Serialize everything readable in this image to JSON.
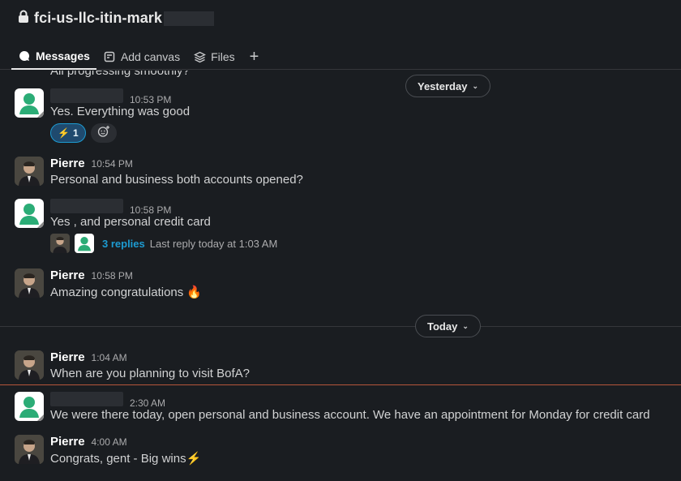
{
  "channel": {
    "name": "fci-us-llc-itin-mark"
  },
  "tabs": [
    {
      "label": "Messages",
      "icon": "chat-bubble-icon"
    },
    {
      "label": "Add canvas",
      "icon": "canvas-icon"
    },
    {
      "label": "Files",
      "icon": "layers-icon"
    }
  ],
  "add_tab_label": "+",
  "partial_message": "All progressing smoothly?",
  "dividers": {
    "yesterday": "Yesterday",
    "today": "Today"
  },
  "messages": [
    {
      "author": "",
      "time": "10:53 PM",
      "text": "Yes. Everything was good"
    },
    {
      "author": "Pierre",
      "time": "10:54 PM",
      "text": "Personal and business both accounts opened?"
    },
    {
      "author": "",
      "time": "10:58 PM",
      "text": "Yes , and personal credit card"
    },
    {
      "author": "Pierre",
      "time": "10:58 PM",
      "text": "Amazing congratulations 🔥"
    },
    {
      "author": "Pierre",
      "time": "1:04 AM",
      "text": "When are you planning to visit BofA?"
    },
    {
      "author": "",
      "time": "2:30 AM",
      "text": "We were there today, open personal and business account. We have an appointment for Monday for credit card"
    },
    {
      "author": "Pierre",
      "time": "4:00 AM",
      "text": "Congrats, gent - Big wins⚡"
    }
  ],
  "reaction": {
    "emoji": "⚡",
    "count": "1"
  },
  "thread": {
    "replies": "3 replies",
    "last_reply": "Last reply today at 1:03 AM"
  },
  "colors": {
    "background": "#1a1d21",
    "link": "#1d9bd1",
    "new_marker": "#b5563b",
    "avatar_green": "#2bac76"
  }
}
